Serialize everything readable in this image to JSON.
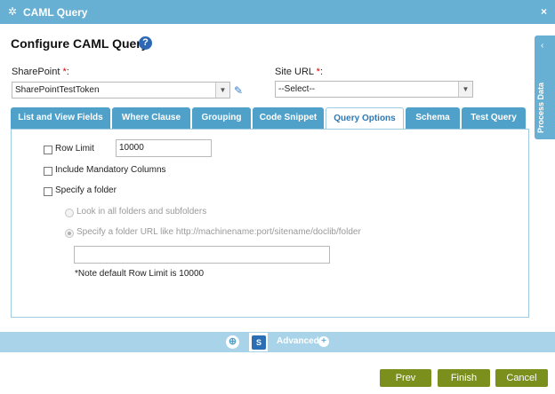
{
  "window": {
    "title": "CAML Query",
    "gear_icon": "gear-icon",
    "close_glyph": "×"
  },
  "page": {
    "heading": "Configure CAML Query",
    "help_glyph": "?"
  },
  "sharepoint": {
    "label": "SharePoint ",
    "required": "*",
    "colon": ":",
    "value": "SharePointTestToken"
  },
  "site_url": {
    "label": "Site URL ",
    "required": "*",
    "colon": ":",
    "value": "--Select--"
  },
  "process_data": {
    "label": "Process Data",
    "chevron": "‹"
  },
  "tabs": [
    {
      "label": "List and View Fields"
    },
    {
      "label": "Where Clause"
    },
    {
      "label": "Grouping"
    },
    {
      "label": "Code Snippet"
    },
    {
      "label": "Query Options"
    },
    {
      "label": "Schema"
    },
    {
      "label": "Test Query"
    }
  ],
  "active_tab": "Query Options",
  "query_options": {
    "row_limit": {
      "label": "Row Limit",
      "value": "10000",
      "checked": false
    },
    "include_mandatory": {
      "label": "Include Mandatory Columns",
      "checked": false
    },
    "specify_folder": {
      "label": "Specify a folder",
      "checked": false
    },
    "radio_all_folders": {
      "label": "Look in all folders and subfolders"
    },
    "radio_folder_url": {
      "label": "Specify a folder URL like http://machinename:port/sitename/doclib/folder"
    },
    "folder_url_value": "",
    "note": "*Note default Row Limit is 10000"
  },
  "bottom_bar": {
    "advanced_label": "Advanced",
    "plus_glyph": "+",
    "globe_glyph": "⊕",
    "sp_glyph": "S"
  },
  "buttons": {
    "prev": "Prev",
    "finish": "Finish",
    "cancel": "Cancel"
  },
  "colors": {
    "accent": "#67b0d3",
    "tab": "#4fa1ca",
    "button": "#7b8f1c"
  }
}
